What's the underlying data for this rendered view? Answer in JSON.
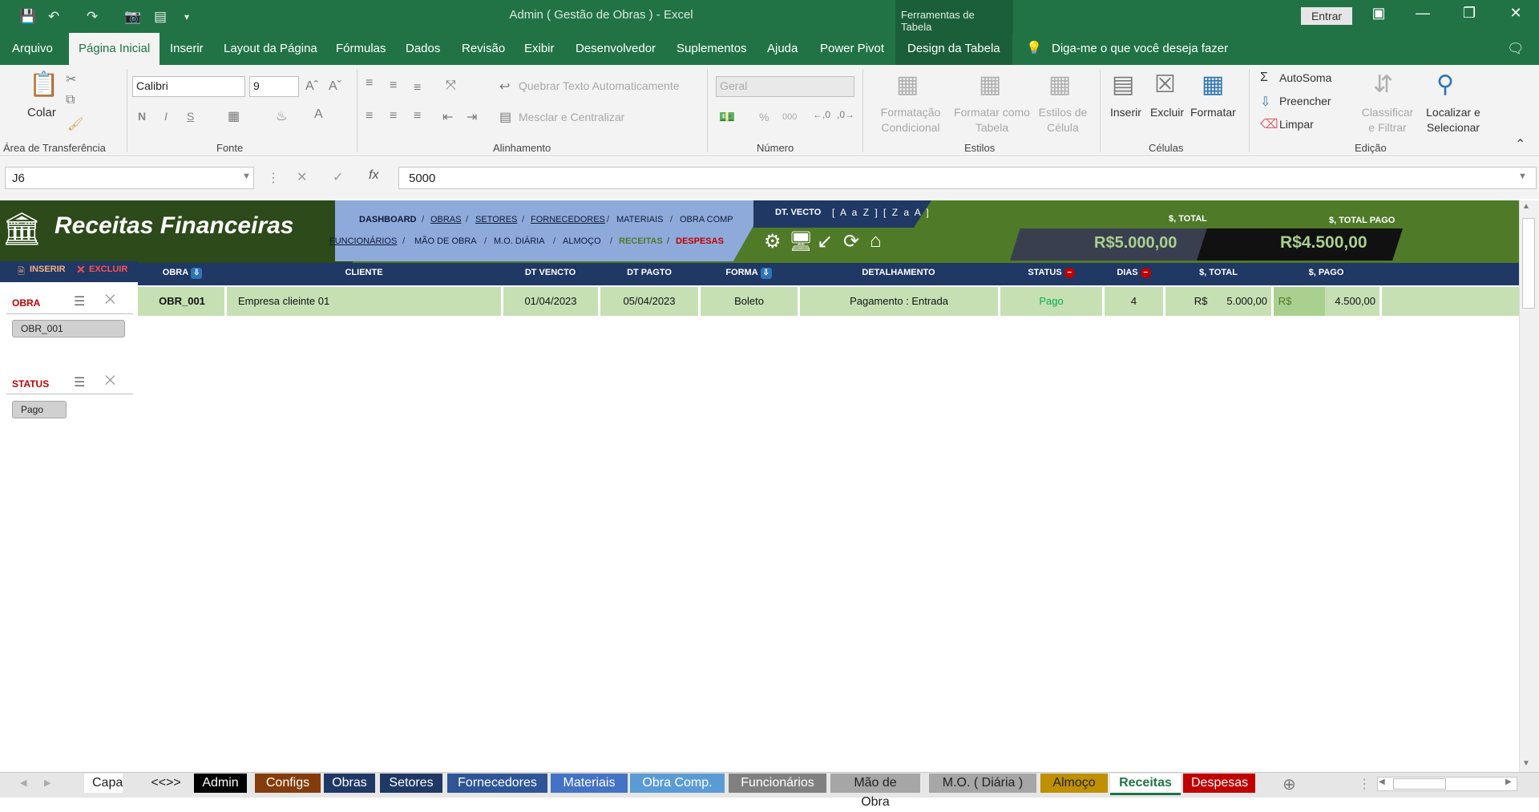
{
  "window": {
    "title": "Admin ( Gestão de Obras )  -  Excel",
    "table_tools": "Ferramentas de Tabela",
    "signin": "Entrar"
  },
  "ribbon_tabs": [
    "Arquivo",
    "Página Inicial",
    "Inserir",
    "Layout da Página",
    "Fórmulas",
    "Dados",
    "Revisão",
    "Exibir",
    "Desenvolvedor",
    "Suplementos",
    "Ajuda",
    "Power Pivot",
    "Design da Tabela"
  ],
  "tell_me": "Diga-me o que você deseja fazer",
  "ribbon": {
    "clipboard": {
      "paste": "Colar",
      "label": "Área de Transferência"
    },
    "font": {
      "name": "Calibri",
      "size": "9",
      "bold": "N",
      "italic": "I",
      "underline": "S",
      "label": "Fonte"
    },
    "alignment": {
      "wrap": "Quebrar Texto Automaticamente",
      "merge": "Mesclar e Centralizar",
      "label": "Alinhamento"
    },
    "number": {
      "format": "Geral",
      "percent": "%",
      "thousands": "000",
      "label": "Número"
    },
    "styles": {
      "cond_line1": "Formatação",
      "cond_line2": "Condicional",
      "table_line1": "Formatar como",
      "table_line2": "Tabela",
      "cell_line1": "Estilos de",
      "cell_line2": "Célula",
      "label": "Estilos"
    },
    "cells": {
      "insert": "Inserir",
      "delete": "Excluir",
      "format": "Formatar",
      "label": "Células"
    },
    "editing": {
      "autosum": "AutoSoma",
      "fill": "Preencher",
      "clear": "Limpar",
      "sort_line1": "Classificar",
      "sort_line2": "e Filtrar",
      "find_line1": "Localizar e",
      "find_line2": "Selecionar",
      "label": "Edição"
    }
  },
  "formula_bar": {
    "cell_ref": "J6",
    "value": "5000"
  },
  "sheet": {
    "title": "Receitas Financeiras",
    "nav_row1": [
      "DASHBOARD",
      "OBRAS",
      "SETORES",
      "FORNECEDORES",
      "MATERIAIS",
      "OBRA COMP"
    ],
    "nav_row2": [
      "FUNCIONÁRIOS",
      "MÃO DE OBRA",
      "M.O. DIÁRIA",
      "ALMOÇO",
      "RECEITAS",
      "DESPESAS"
    ],
    "dt_vecto": "DT. VECTO",
    "sort_links": "[ A a Z ] [ Z a A ]",
    "total_label": "$, TOTAL",
    "total_value": "R$5.000,00",
    "total_pago_label": "$, TOTAL PAGO",
    "total_pago_value": "R$4.500,00",
    "btn_inserir": "INSERIR",
    "btn_excluir": "EXCLUIR",
    "columns": [
      "OBRA",
      "CLIENTE",
      "DT VENCTO",
      "DT PAGTO",
      "FORMA",
      "DETALHAMENTO",
      "STATUS",
      "DIAS",
      "$, TOTAL",
      "$, PAGO"
    ],
    "rows": [
      {
        "obra": "OBR_001",
        "cliente": "Empresa clieinte 01",
        "dt_vencto": "01/04/2023",
        "dt_pagto": "05/04/2023",
        "forma": "Boleto",
        "detalhamento": "Pagamento : Entrada",
        "status": "Pago",
        "dias": "4",
        "total_cur": "R$",
        "total": "5.000,00",
        "pago_cur": "R$",
        "pago": "4.500,00"
      }
    ],
    "slicers": [
      {
        "title": "OBRA",
        "items": [
          "OBR_001"
        ]
      },
      {
        "title": "STATUS",
        "items": [
          "Pago"
        ]
      }
    ]
  },
  "sheet_tabs": [
    {
      "label": "Capa",
      "color": "#ffffff",
      "text": "#222222"
    },
    {
      "label": "<<>>",
      "color": "#e6e6e6",
      "text": "#222222"
    },
    {
      "label": "Admin",
      "color": "#000000",
      "text": "#ffffff"
    },
    {
      "label": "Configs",
      "color": "#843c0c",
      "text": "#ffffff"
    },
    {
      "label": "Obras",
      "color": "#1f3864",
      "text": "#ffffff"
    },
    {
      "label": "Setores",
      "color": "#203864",
      "text": "#ffffff"
    },
    {
      "label": "Fornecedores",
      "color": "#2f5597",
      "text": "#ffffff"
    },
    {
      "label": "Materiais",
      "color": "#4472c4",
      "text": "#ffffff"
    },
    {
      "label": "Obra Comp.",
      "color": "#5b9bd5",
      "text": "#ffffff"
    },
    {
      "label": "Funcionários",
      "color": "#808080",
      "text": "#ffffff"
    },
    {
      "label": "Mão de Obra",
      "color": "#a6a6a6",
      "text": "#222222"
    },
    {
      "label": "M.O. ( Diária )",
      "color": "#a6a6a6",
      "text": "#222222"
    },
    {
      "label": "Almoço",
      "color": "#bf9000",
      "text": "#222222"
    },
    {
      "label": "Receitas",
      "color": "#ffffff",
      "text": "#217346"
    },
    {
      "label": "Despesas",
      "color": "#c00000",
      "text": "#ffffff"
    }
  ],
  "colors": {
    "excel_green": "#217346",
    "header_green": "#4f7a28",
    "navy": "#1f3864",
    "row_green": "#c6e0b4",
    "status_green": "#00b050"
  }
}
